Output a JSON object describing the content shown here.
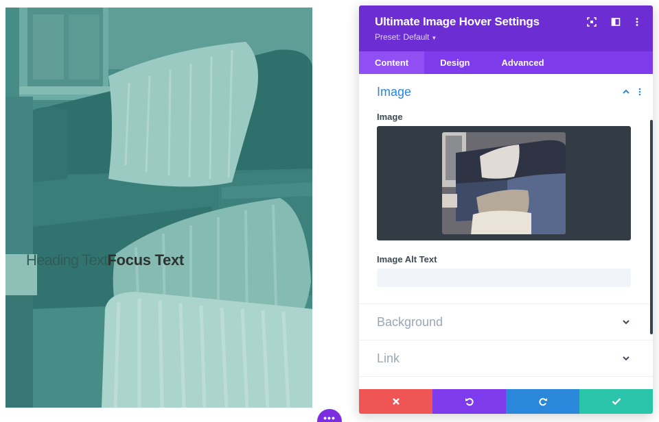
{
  "preview": {
    "heading_text": "Heading Text",
    "focus_text": "Focus Text"
  },
  "more_button": {
    "label": "•••"
  },
  "panel": {
    "title": "Ultimate Image Hover Settings",
    "preset_label": "Preset: Default",
    "tabs": [
      {
        "label": "Content",
        "active": true
      },
      {
        "label": "Design",
        "active": false
      },
      {
        "label": "Advanced",
        "active": false
      }
    ],
    "sections": {
      "image": {
        "title": "Image",
        "image_field_label": "Image",
        "alt_text_label": "Image Alt Text",
        "alt_text_value": ""
      },
      "background": {
        "title": "Background"
      },
      "link": {
        "title": "Link"
      }
    },
    "footer": {
      "discard_icon": "x-icon",
      "undo_icon": "undo-icon",
      "redo_icon": "redo-icon",
      "save_icon": "check-icon"
    }
  },
  "colors": {
    "panel_header": "#6c2dd3",
    "tabs_bar": "#7e3bec",
    "accent_blue": "#2b87da",
    "discard": "#ef5555",
    "save": "#29c4a9",
    "preview_tint": "#3f7f7a"
  }
}
